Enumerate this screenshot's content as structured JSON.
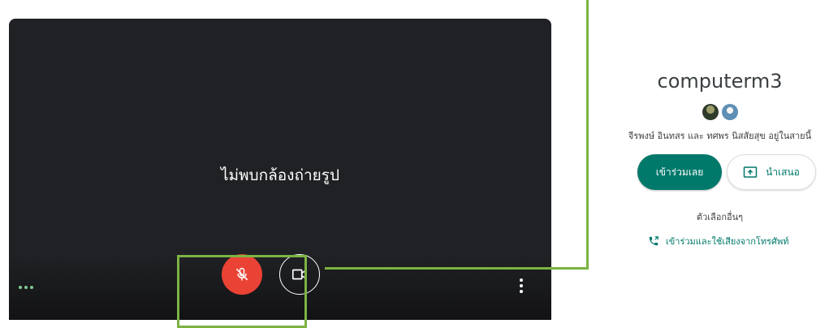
{
  "preview": {
    "no_camera_text": "ไม่พบกล้องถ่ายรูป"
  },
  "controls": {
    "mic_icon": "mic-off-icon",
    "camera_icon": "videocam-icon",
    "more_left_icon": "more-horiz-icon",
    "more_right_icon": "more-vert-icon",
    "mic_color": "#ea4335"
  },
  "panel": {
    "meeting_title": "computerm3",
    "participants_text": "จีรพงษ์ อินทสร และ ทศพร นิสสัยสุข อยู่ในสายนี้",
    "join_label": "เข้าร่วมเลย",
    "present_label": "นำเสนอ",
    "other_options_label": "ตัวเลือกอื่นๆ",
    "phone_join_label": "เข้าร่วมและใช้เสียงจากโทรศัพท์"
  },
  "colors": {
    "accent": "#00796b",
    "annotation": "#7cb342",
    "preview_bg": "#202124"
  }
}
